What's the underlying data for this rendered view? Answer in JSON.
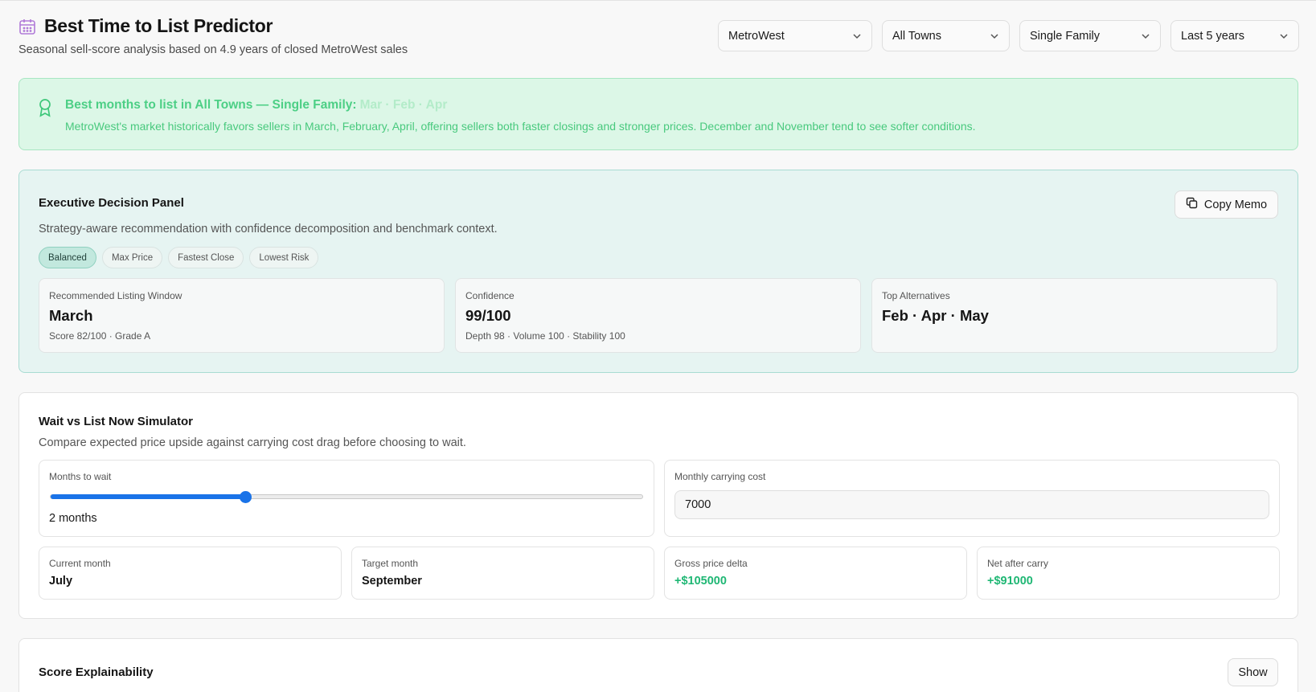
{
  "header": {
    "title": "Best Time to List Predictor",
    "subtitle": "Seasonal sell-score analysis based on 4.9 years of closed MetroWest sales",
    "icon": "calendar-icon"
  },
  "filters": {
    "region": "MetroWest",
    "town": "All Towns",
    "property_type": "Single Family",
    "period": "Last 5 years"
  },
  "banner": {
    "title": "Best months to list in All Towns — Single Family:",
    "months": "Mar · Feb · Apr",
    "text": "MetroWest's market historically favors sellers in March, February, April, offering sellers both faster closings and stronger prices. December and November tend to see softer conditions."
  },
  "executive": {
    "title": "Executive Decision Panel",
    "subtitle": "Strategy-aware recommendation with confidence decomposition and benchmark context.",
    "copy_label": "Copy Memo",
    "strategies": [
      "Balanced",
      "Max Price",
      "Fastest Close",
      "Lowest Risk"
    ],
    "active_strategy": "Balanced",
    "boxes": [
      {
        "label": "Recommended Listing Window",
        "value": "March",
        "meta": "Score 82/100 · Grade A"
      },
      {
        "label": "Confidence",
        "value": "99/100",
        "meta": "Depth 98 · Volume 100 · Stability 100"
      },
      {
        "label": "Top Alternatives",
        "value": "Feb · Apr · May",
        "meta": ""
      }
    ]
  },
  "simulator": {
    "title": "Wait vs List Now Simulator",
    "subtitle": "Compare expected price upside against carrying cost drag before choosing to wait.",
    "wait_label": "Months to wait",
    "wait_value_text": "2 months",
    "wait_fraction": 0.33,
    "cost_label": "Monthly carrying cost",
    "cost_value": "7000",
    "metrics": [
      {
        "label": "Current month",
        "value": "July"
      },
      {
        "label": "Target month",
        "value": "September"
      },
      {
        "label": "Gross price delta",
        "value": "+$105000"
      },
      {
        "label": "Net after carry",
        "value": "+$91000"
      }
    ]
  },
  "explainability": {
    "title": "Score Explainability",
    "show_label": "Show"
  },
  "colors": {
    "accent_green": "#1fb774",
    "slider_blue": "#1a73e8",
    "banner_bg": "#dcf7e7",
    "exec_bg": "#e6f4f2"
  }
}
